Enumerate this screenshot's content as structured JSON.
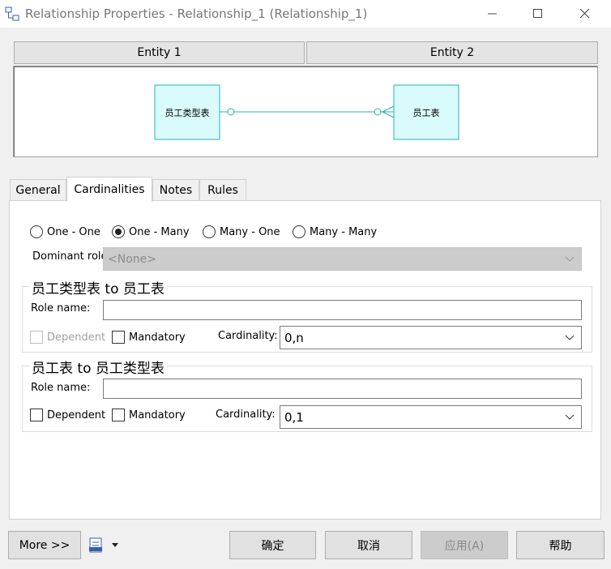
{
  "window": {
    "title": "Relationship Properties - Relationship_1 (Relationship_1)",
    "icon": "relationship-icon",
    "controls": [
      "minimize-icon",
      "maximize-icon",
      "close-icon"
    ]
  },
  "entities": {
    "entity1_header": "Entity 1",
    "entity2_header": "Entity 2",
    "diagram": {
      "left_entity": "员工类型表",
      "right_entity": "员工表",
      "color": "#d9fbfb",
      "border_color": "#2ab0b0"
    }
  },
  "tabs": [
    {
      "label": "General",
      "active": false
    },
    {
      "label": "Cardinalities",
      "active": true
    },
    {
      "label": "Notes",
      "active": false
    },
    {
      "label": "Rules",
      "active": false
    }
  ],
  "cardinality_options": [
    {
      "label": "One - One",
      "selected": false
    },
    {
      "label": "One - Many",
      "selected": true
    },
    {
      "label": "Many - One",
      "selected": false
    },
    {
      "label": "Many - Many",
      "selected": false
    }
  ],
  "dominant_role": {
    "label": "Dominant role:",
    "value": "<None>",
    "disabled": true
  },
  "group1": {
    "title": "员工类型表 to 员工表",
    "role_name_label": "Role name:",
    "role_name_value": "",
    "dependent_label": "Dependent",
    "dependent_checked": false,
    "dependent_disabled": true,
    "mandatory_label": "Mandatory",
    "mandatory_checked": false,
    "cardinality_label": "Cardinality:",
    "cardinality_value": "0,n"
  },
  "group2": {
    "title": "员工表 to 员工类型表",
    "role_name_label": "Role name:",
    "role_name_value": "",
    "dependent_label": "Dependent",
    "dependent_checked": false,
    "dependent_disabled": false,
    "mandatory_label": "Mandatory",
    "mandatory_checked": false,
    "cardinality_label": "Cardinality:",
    "cardinality_value": "0,1"
  },
  "footer": {
    "more_label": "More >>",
    "tool_icon": "printer-icon",
    "ok_label": "确定",
    "cancel_label": "取消",
    "apply_label": "应用(A)",
    "help_label": "帮助"
  }
}
